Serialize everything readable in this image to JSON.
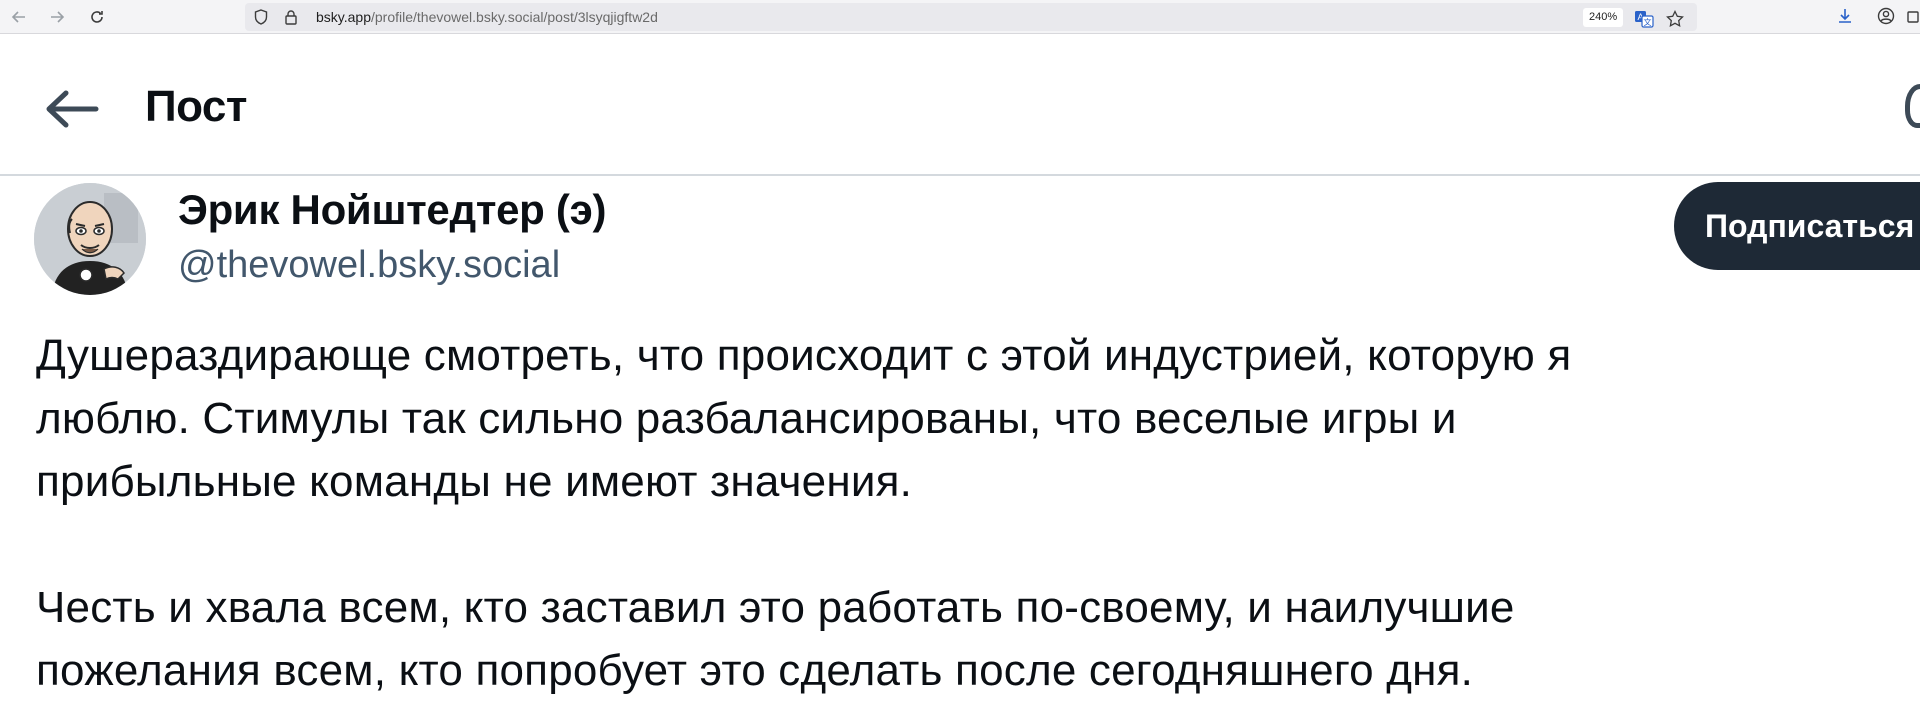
{
  "browser": {
    "url_host": "bsky.app",
    "url_path": "/profile/thevowel.bsky.social/post/3lsyqjigftw2d",
    "zoom_level": "240%"
  },
  "header": {
    "title": "Пост"
  },
  "post": {
    "author_name": "Эрик Нойштедтер (э)",
    "author_handle": "@thevowel.bsky.social",
    "follow_label": "Подписаться",
    "paragraph1": [
      "Душераздирающе смотреть, что происходит с этой индустрией, которую я",
      "люблю. Стимулы так сильно разбалансированы, что веселые игры и",
      "прибыльные команды не имеют значения."
    ],
    "paragraph2": [
      "Честь и хвала всем, кто заставил это работать по-своему, и наилучшие",
      "пожелания всем, кто попробует это сделать после сегодняшнего дня."
    ]
  },
  "colors": {
    "follow_button_bg": "#1e2936",
    "handle_text": "#42576c",
    "divider": "#d4d9de"
  }
}
